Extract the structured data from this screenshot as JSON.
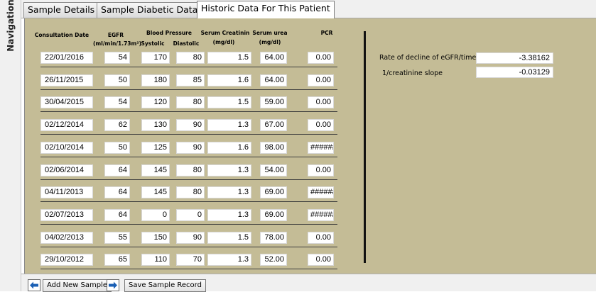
{
  "navigation": {
    "label": "Navigation"
  },
  "tabs": [
    {
      "label": "Sample Details",
      "active": false
    },
    {
      "label": "Sample Diabetic Data",
      "active": false
    },
    {
      "label": "Historic Data For This Patient",
      "active": true
    }
  ],
  "headers": {
    "consultation_date": "Consultation Date",
    "egfr": "EGFR",
    "egfr_unit": "(ml/min/1.73m²)",
    "blood_pressure": "Blood Pressure",
    "systolic": "Systolic",
    "diastolic": "Diastolic",
    "serum_creatinin": "Serum Creatinin",
    "creatinin_unit": "(mg/dl)",
    "serum_urea": "Serum urea",
    "urea_unit": "(mg/dl)",
    "pcr": "PCR"
  },
  "rows": [
    {
      "date": "22/01/2016",
      "egfr": "54",
      "systolic": "170",
      "diastolic": "80",
      "creatinin": "1.5",
      "urea": "64.00",
      "pcr": "0.00"
    },
    {
      "date": "26/11/2015",
      "egfr": "50",
      "systolic": "180",
      "diastolic": "85",
      "creatinin": "1.6",
      "urea": "64.00",
      "pcr": "0.00"
    },
    {
      "date": "30/04/2015",
      "egfr": "54",
      "systolic": "120",
      "diastolic": "80",
      "creatinin": "1.5",
      "urea": "59.00",
      "pcr": "0.00"
    },
    {
      "date": "02/12/2014",
      "egfr": "62",
      "systolic": "130",
      "diastolic": "90",
      "creatinin": "1.3",
      "urea": "67.00",
      "pcr": "0.00"
    },
    {
      "date": "02/10/2014",
      "egfr": "50",
      "systolic": "125",
      "diastolic": "90",
      "creatinin": "1.6",
      "urea": "98.00",
      "pcr": "######"
    },
    {
      "date": "02/06/2014",
      "egfr": "64",
      "systolic": "145",
      "diastolic": "80",
      "creatinin": "1.3",
      "urea": "54.00",
      "pcr": "0.00"
    },
    {
      "date": "04/11/2013",
      "egfr": "64",
      "systolic": "145",
      "diastolic": "80",
      "creatinin": "1.3",
      "urea": "69.00",
      "pcr": "######"
    },
    {
      "date": "02/07/2013",
      "egfr": "64",
      "systolic": "0",
      "diastolic": "0",
      "creatinin": "1.3",
      "urea": "69.00",
      "pcr": "######"
    },
    {
      "date": "04/02/2013",
      "egfr": "55",
      "systolic": "150",
      "diastolic": "90",
      "creatinin": "1.5",
      "urea": "78.00",
      "pcr": "0.00"
    },
    {
      "date": "29/10/2012",
      "egfr": "65",
      "systolic": "110",
      "diastolic": "70",
      "creatinin": "1.3",
      "urea": "52.00",
      "pcr": "0.00"
    }
  ],
  "stats": {
    "egfr_decline_label": "Rate of decline of eGFR/time",
    "egfr_decline_value": "-3.38162",
    "creatinine_slope_label": "1/creatinine slope",
    "creatinine_slope_value": "-0.03129"
  },
  "toolbar": {
    "prev_icon": "arrow-left-icon",
    "next_icon": "arrow-right-icon",
    "add_label": "Add New Sample",
    "save_label": "Save Sample Record"
  },
  "colors": {
    "panel_background": "#c4bc96",
    "arrow_blue": "#1a5fb4"
  }
}
